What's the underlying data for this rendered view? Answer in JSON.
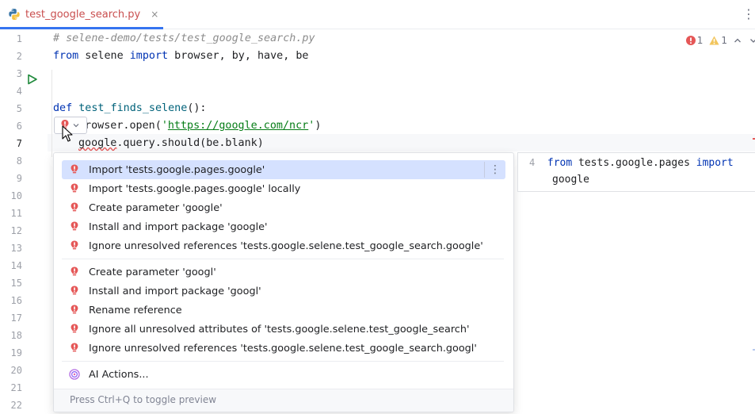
{
  "tab": {
    "file_name": "test_google_search.py",
    "close_glyph": "×",
    "more_glyph": "⋮"
  },
  "inspection": {
    "errors": "1",
    "warnings": "1"
  },
  "gutter": {
    "line_numbers": [
      "1",
      "2",
      "3",
      "4",
      "5",
      "6",
      "7",
      "8",
      "9",
      "10",
      "11",
      "12",
      "13",
      "14",
      "15",
      "16",
      "17",
      "18",
      "19",
      "20",
      "21",
      "22"
    ]
  },
  "code": {
    "line1_comment": "# selene-demo/tests/test_google_search.py",
    "line2": {
      "kw_from": "from",
      "module": " selene ",
      "kw_import": "import",
      "names": " browser, by, have, be"
    },
    "line5": {
      "kw_def": "def",
      "fn": "test_finds_selene",
      "rest": "():"
    },
    "line6": {
      "prefix": "browser.open(",
      "q1": "'",
      "url": "https://google.com/ncr",
      "q2": "'",
      "suffix": ")"
    },
    "line7": {
      "unresolved": "google",
      "rest": ".query.should(be.blank)"
    }
  },
  "popup": {
    "items": [
      "Import 'tests.google.pages.google'",
      "Import 'tests.google.pages.google' locally",
      "Create parameter 'google'",
      "Install and import package 'google'",
      "Ignore unresolved references 'tests.google.selene.test_google_search.google'",
      "Create parameter 'googl'",
      "Install and import package 'googl'",
      "Rename reference",
      "Ignore all unresolved attributes of 'tests.google.selene.test_google_search'",
      "Ignore unresolved references 'tests.google.selene.test_google_search.googl'",
      "AI Actions..."
    ],
    "kebab": "⋮",
    "footer": "Press Ctrl+Q to toggle preview"
  },
  "preview": {
    "line_no": "4",
    "kw_from": "from",
    "module": " tests.google.pages ",
    "kw_import": "import",
    "name": "google"
  },
  "colors": {
    "accent": "#3574f0",
    "error": "#e55757",
    "selection": "#d5e1ff",
    "keyword": "#0033b3",
    "string": "#067d17"
  }
}
